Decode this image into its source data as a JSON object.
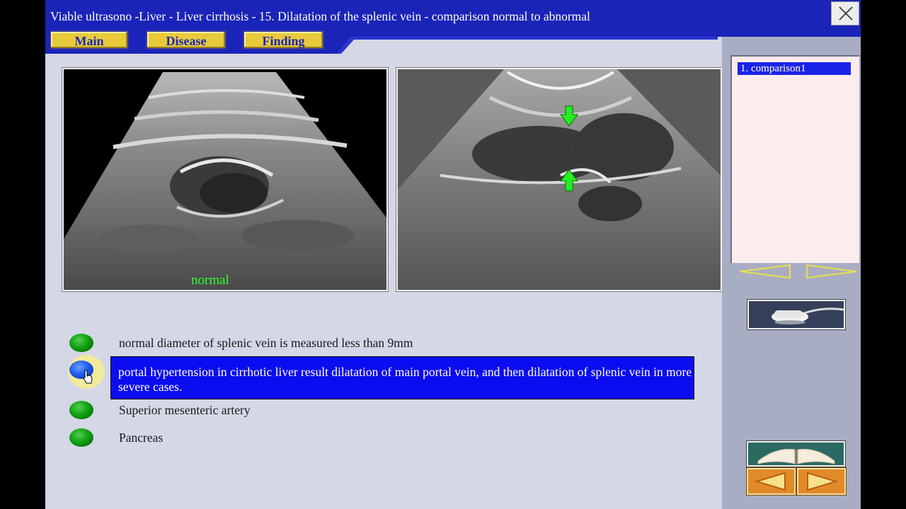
{
  "window": {
    "title": "Viable ultrasono -Liver - Liver cirrhosis - 15. Dilatation of the splenic vein - comparison normal to abnormal"
  },
  "nav": {
    "main_label": "Main",
    "disease_label": "Disease",
    "finding_label": "Finding"
  },
  "images": {
    "left_caption": "normal"
  },
  "sidebar": {
    "items": [
      {
        "label": "1. comparison1",
        "selected": true
      }
    ]
  },
  "findings": [
    {
      "text": "normal diameter of splenic vein is measured less than 9mm",
      "indicator": "green",
      "selected": false
    },
    {
      "text": "portal hypertension in cirrhotic liver result dilatation of main portal vein, and then dilatation of splenic vein in more severe cases.",
      "indicator": "blue",
      "selected": true
    },
    {
      "text": "Superior mesenteric artery",
      "indicator": "green",
      "selected": false
    },
    {
      "text": "Pancreas",
      "indicator": "green",
      "selected": false
    }
  ],
  "colors": {
    "title_bar": "#1a24b8",
    "nav_button": "#e8ca3a",
    "highlight": "#0c0cf0",
    "caption_green": "#32ff32",
    "arrow_green": "#22ee22"
  },
  "icons": [
    "close-icon",
    "nav-left-arrow-icon",
    "nav-right-arrow-icon",
    "ultrasound-probe-icon",
    "book-icon",
    "prev-arrow-icon",
    "next-arrow-icon",
    "cursor-hand-icon"
  ]
}
